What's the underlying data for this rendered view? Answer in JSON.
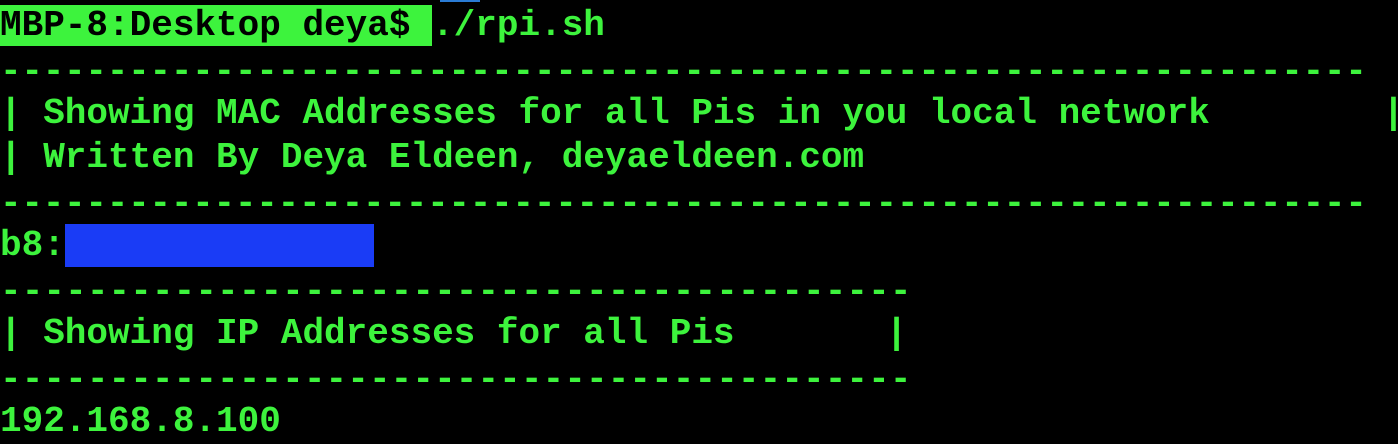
{
  "terminal": {
    "prompt": "MBP-8:Desktop deya$ ",
    "command": "./rpi.sh",
    "separator_long": "----------------------------------------------------------------",
    "mac_header": "| Showing MAC Addresses for all Pis in you local network        |",
    "author_line": "| Written By Deya Eldeen, deyaeldeen.com                         |",
    "mac_prefix": "b8:",
    "separator_short": "------------------------------------------",
    "ip_header": "| Showing IP Addresses for all Pis       |",
    "ip_result": "192.168.8.100"
  },
  "colors": {
    "background": "#000000",
    "text": "#3df33d",
    "redaction": "#1a3cf6"
  }
}
